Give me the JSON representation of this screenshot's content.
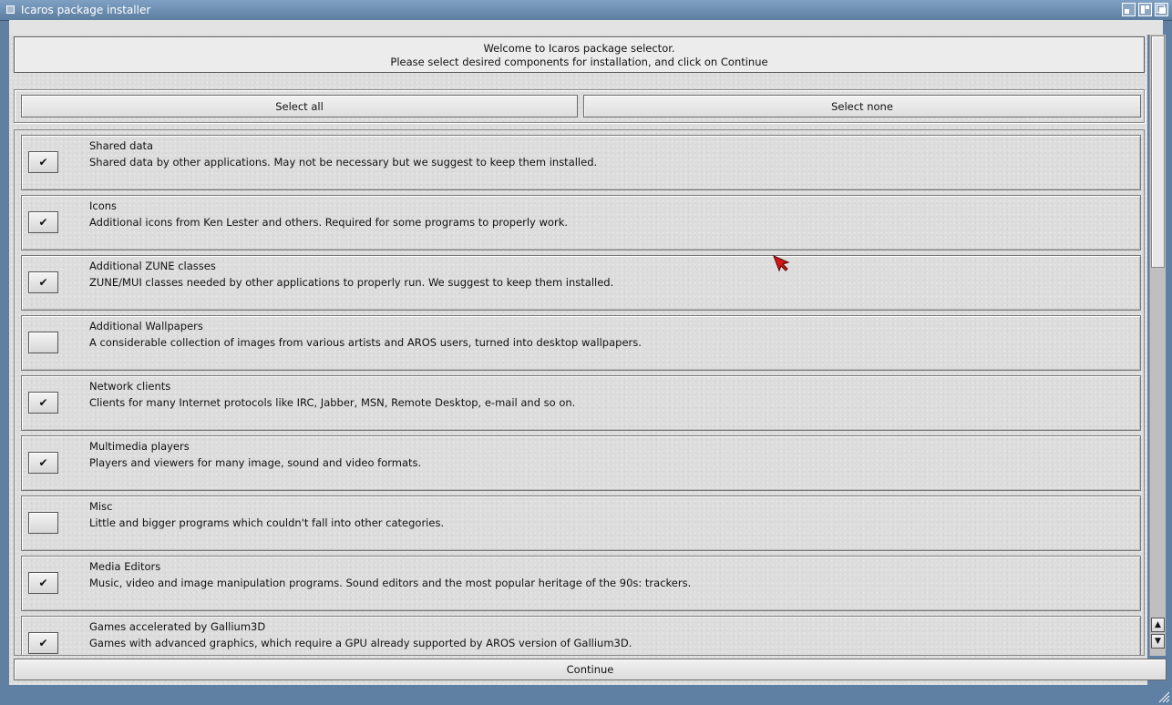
{
  "window": {
    "title": "Icaros package installer"
  },
  "welcome": {
    "line1": "Welcome to Icaros package selector.",
    "line2": "Please select desired components for installation, and click on Continue"
  },
  "buttons": {
    "select_all": "Select all",
    "select_none": "Select none",
    "continue": "Continue"
  },
  "packages": [
    {
      "name": "Shared data",
      "description": "Shared data by other applications. May not be necessary but we suggest to keep them installed.",
      "checked": true,
      "check_glyph": "✔"
    },
    {
      "name": "Icons",
      "description": "Additional icons from Ken Lester and others. Required for some programs to properly work.",
      "checked": true,
      "check_glyph": "✔"
    },
    {
      "name": "Additional ZUNE classes",
      "description": "ZUNE/MUI classes needed by other applications to properly run. We suggest to keep them installed.",
      "checked": true,
      "check_glyph": "✔"
    },
    {
      "name": "Additional Wallpapers",
      "description": "A considerable collection of images from various artists and AROS users, turned into desktop wallpapers.",
      "checked": false,
      "check_glyph": ""
    },
    {
      "name": "Network clients",
      "description": "Clients for many Internet protocols like IRC, Jabber, MSN, Remote Desktop, e-mail and so on.",
      "checked": true,
      "check_glyph": "✔"
    },
    {
      "name": "Multimedia players",
      "description": "Players and viewers for many image, sound and video formats.",
      "checked": true,
      "check_glyph": "✔"
    },
    {
      "name": "Misc",
      "description": "Little and bigger programs which couldn't fall into other categories.",
      "checked": false,
      "check_glyph": ""
    },
    {
      "name": "Media Editors",
      "description": "Music, video and image manipulation programs. Sound editors and the most popular heritage of the 90s: trackers.",
      "checked": true,
      "check_glyph": "✔"
    },
    {
      "name": "Games accelerated by Gallium3D",
      "description": "Games with advanced graphics, which require a GPU already supported by AROS version of Gallium3D.",
      "checked": true,
      "check_glyph": "✔"
    }
  ],
  "scrollbar": {
    "up_glyph": "▲",
    "down_glyph": "▼",
    "visible_fraction": 0.4
  },
  "colors": {
    "title_bar": "#6d8fb3",
    "window_bg": "#dcdcdc",
    "cursor": "#d01818"
  }
}
